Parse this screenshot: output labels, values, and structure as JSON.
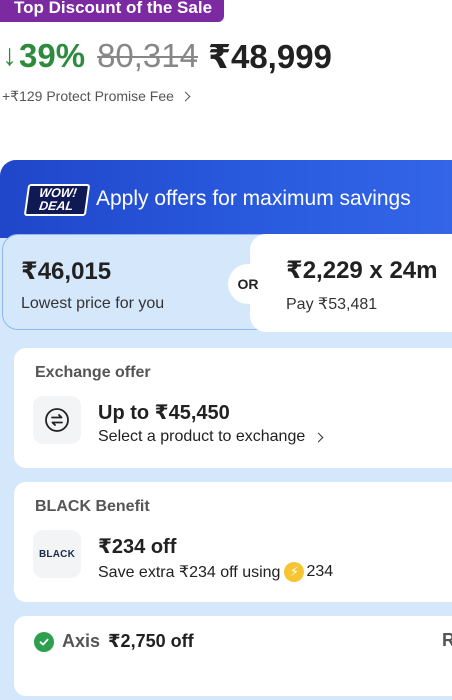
{
  "badge": {
    "label": "Top Discount of the Sale"
  },
  "price": {
    "arrow": "↓",
    "discount": "39%",
    "mrp": "80,314",
    "final": "₹48,999"
  },
  "fee": {
    "label": "+₹129 Protect Promise Fee"
  },
  "offers": {
    "logo_top": "WOW!",
    "logo_bottom": "DEAL",
    "title": "Apply offers for maximum savings",
    "lowest": {
      "amount": "₹46,015",
      "sub": "Lowest price for you"
    },
    "or_label": "OR",
    "emi": {
      "amount": "₹2,229 x 24m",
      "sub": "Pay ₹53,481"
    },
    "exchange": {
      "title": "Exchange offer",
      "main": "Up to ₹45,450",
      "sub": "Select a product to exchange"
    },
    "black": {
      "title": "BLACK Benefit",
      "logo": "BLACK",
      "main": "₹234 off",
      "sub": "Save extra ₹234 off using",
      "coin_amount": "234"
    },
    "bank": {
      "name": "Axis",
      "amount": "₹2,750 off",
      "trail": "R"
    }
  }
}
